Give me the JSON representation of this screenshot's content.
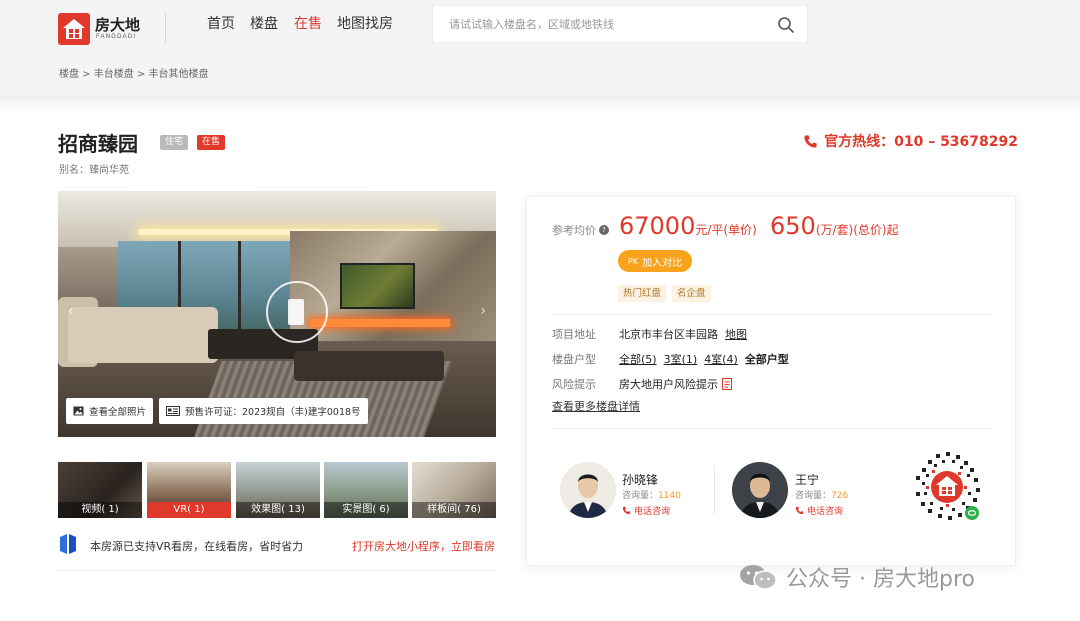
{
  "header": {
    "logo_cn": "房大地",
    "logo_en": "FANGDADI",
    "nav": [
      "首页",
      "楼盘",
      "在售",
      "地图找房"
    ],
    "nav_active_index": 2,
    "search_placeholder": "请试试输入楼盘名，区域或地铁线"
  },
  "breadcrumb": "楼盘 > 丰台楼盘 > 丰台其他楼盘",
  "project": {
    "name": "招商臻园",
    "tag_type": "住宅",
    "tag_status": "在售",
    "alias": "别名：臻尚华苑",
    "hotline": "官方热线：010 – 53678292"
  },
  "gallery": {
    "view_all": "查看全部照片",
    "license": "预售许可证：2023规自（丰)建字0018号",
    "thumbs": [
      {
        "label": "视频( 1)"
      },
      {
        "label": "VR( 1)"
      },
      {
        "label": "效果图( 13)"
      },
      {
        "label": "实景图( 6)"
      },
      {
        "label": "样板间( 76)"
      }
    ],
    "active_thumb": 1,
    "vr_notice": "本房源已支持VR看房，在线看房，省时省力",
    "vr_link": "打开房大地小程序，立即看房"
  },
  "price": {
    "label": "参考均价",
    "unit_price": "67000",
    "unit_price_suffix": "元/平(单价)",
    "total_price": "650",
    "total_price_suffix": "(万/套)(总价)起",
    "compare_btn": "加入对比",
    "chips": [
      "热门红盘",
      "名企盘"
    ]
  },
  "details": {
    "address_label": "项目地址",
    "address": "北京市丰台区丰园路",
    "map_link": "地图",
    "layout_label": "楼盘户型",
    "layouts": [
      "全部(5)",
      "3室(1)",
      "4室(4)",
      "全部户型"
    ],
    "risk_label": "风险提示",
    "risk": "房大地用户风险提示",
    "more_link": "查看更多楼盘详情"
  },
  "agents": [
    {
      "name": "孙晓锋",
      "consult_label": "咨询量：",
      "consult_count": "1140",
      "call": "电话咨询"
    },
    {
      "name": "王宁",
      "consult_label": "咨询量：",
      "consult_count": "726",
      "call": "电话咨询"
    }
  ],
  "watermark": "公众号 · 房大地pro",
  "colors": {
    "brand_red": "#e0382b",
    "orange": "#f9a21b"
  }
}
